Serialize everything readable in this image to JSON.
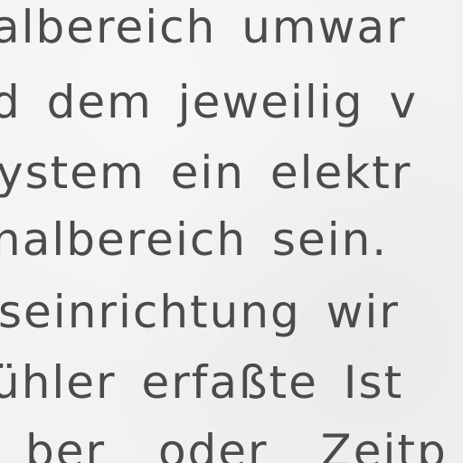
{
  "document": {
    "lines": [
      "albereich umwar",
      "d dem jeweilig v",
      "ystem ein elektr",
      "nalbereich sein.",
      "seinrichtung wir",
      "ühler erfaßte Ist",
      "ber oder Zeitp"
    ]
  },
  "colors": {
    "text": "#4b4b4b",
    "paper": "#f2f2f0"
  }
}
